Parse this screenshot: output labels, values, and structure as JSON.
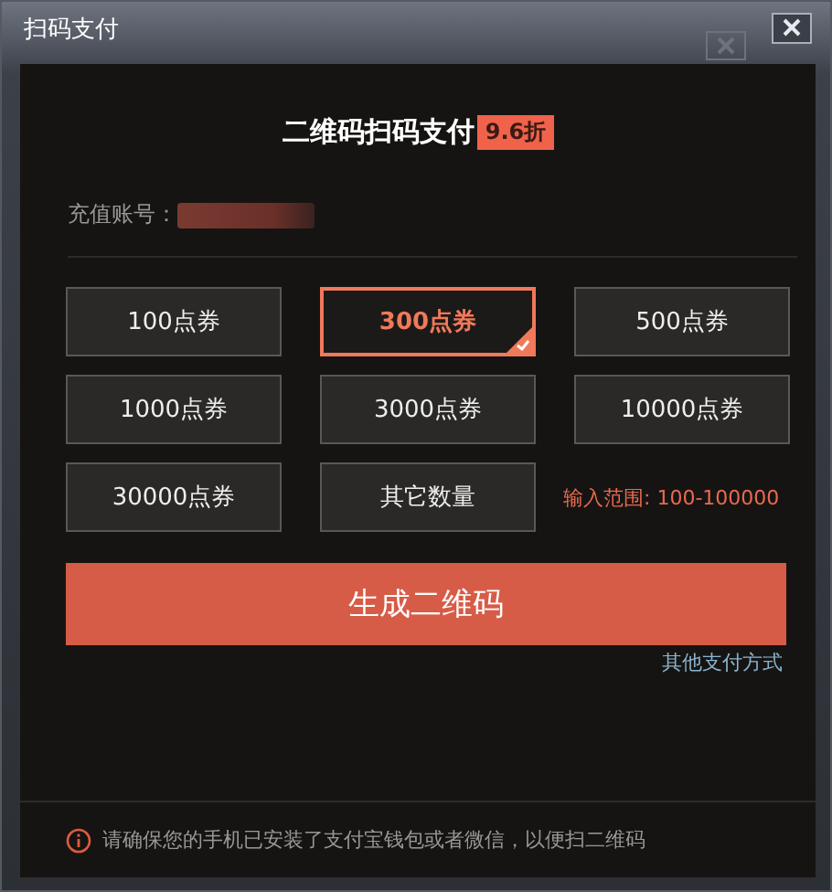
{
  "window": {
    "title": "扫码支付"
  },
  "header": {
    "title": "二维码扫码支付",
    "discount": "9.6折"
  },
  "account": {
    "label": "充值账号："
  },
  "options": [
    {
      "label": "100点券",
      "selected": false
    },
    {
      "label": "300点券",
      "selected": true
    },
    {
      "label": "500点券",
      "selected": false
    },
    {
      "label": "1000点券",
      "selected": false
    },
    {
      "label": "3000点券",
      "selected": false
    },
    {
      "label": "10000点券",
      "selected": false
    },
    {
      "label": "30000点券",
      "selected": false
    },
    {
      "label": "其它数量",
      "selected": false
    }
  ],
  "range_hint": "输入范围: 100-100000",
  "generate_button": "生成二维码",
  "other_payment_link": "其他支付方式",
  "notice": "请确保您的手机已安装了支付宝钱包或者微信，以便扫二维码"
}
